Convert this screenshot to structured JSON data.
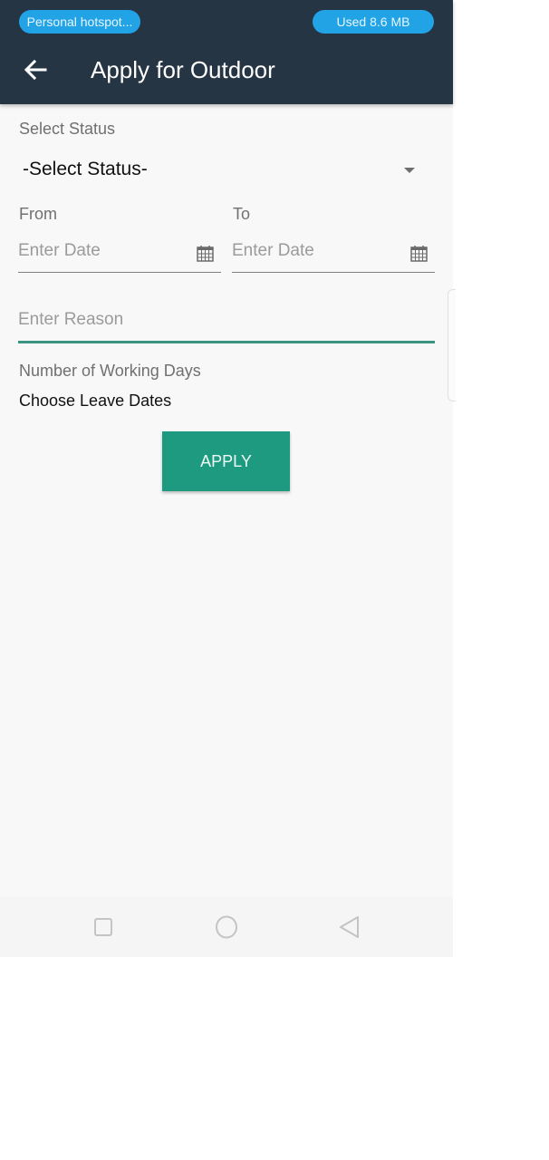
{
  "status_bar": {
    "hotspot_label": "Personal hotspot...",
    "data_usage_label": "Used  8.6 MB"
  },
  "app_bar": {
    "back_icon": "arrow-left-icon",
    "title": "Apply for Outdoor"
  },
  "form": {
    "status_label": "Select Status",
    "status_selected": "-Select Status-",
    "from_label": "From",
    "to_label": "To",
    "from_placeholder": "Enter Date",
    "to_placeholder": "Enter Date",
    "from_value": "",
    "to_value": "",
    "calendar_icon": "calendar-icon",
    "reason_placeholder": "Enter Reason",
    "reason_value": "",
    "working_days_label": "Number of Working Days",
    "working_days_value": "Choose Leave Dates",
    "apply_label": "APPLY"
  },
  "colors": {
    "app_bar": "#263544",
    "accent": "#1e9a80",
    "pill": "#21a3e6"
  },
  "nav_bar": {
    "recents_icon": "square-icon",
    "home_icon": "circle-icon",
    "back_icon": "triangle-back-icon"
  }
}
